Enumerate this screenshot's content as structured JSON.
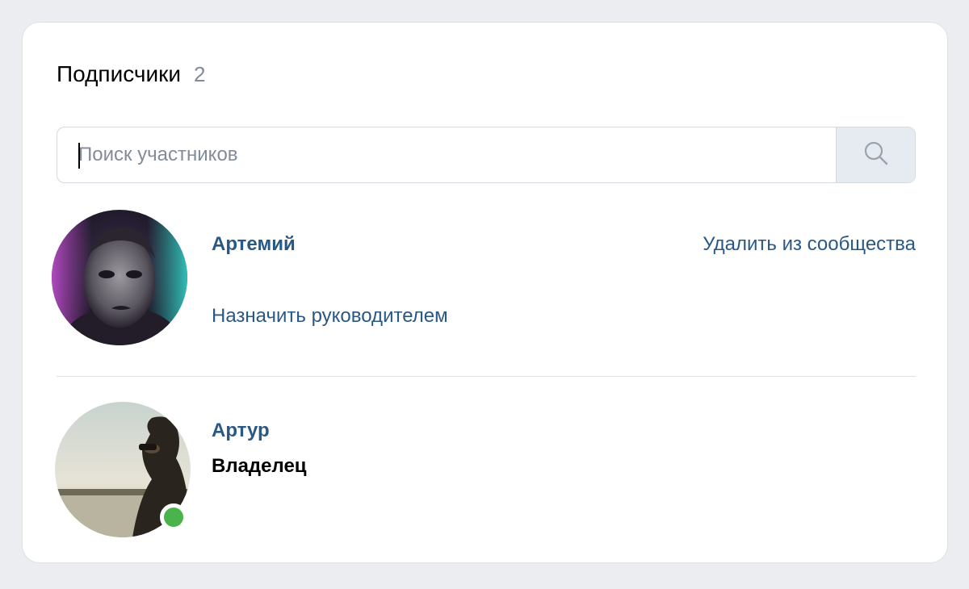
{
  "header": {
    "title": "Подписчики",
    "count": "2"
  },
  "search": {
    "placeholder": "Поиск участников",
    "value": "",
    "icon": "search-icon"
  },
  "members": [
    {
      "name": "Артемий",
      "remove_label": "Удалить из сообщества",
      "assign_label": "Назначить руководителем",
      "online": false
    },
    {
      "name": "Артур",
      "role": "Владелец",
      "online": true
    }
  ],
  "colors": {
    "link": "#2a5885",
    "muted": "#818c99",
    "online": "#4bb34b",
    "background": "#ebedf0"
  }
}
